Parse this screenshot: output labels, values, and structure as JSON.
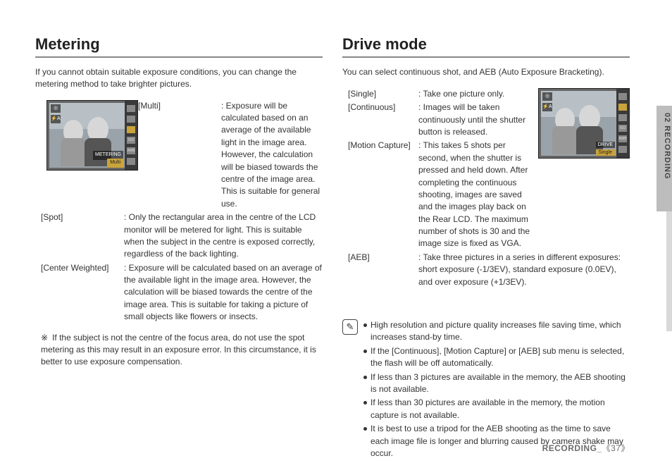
{
  "sideTab": "02 RECORDING",
  "footer": {
    "section": "RECORDING_",
    "page": "37"
  },
  "left": {
    "heading": "Metering",
    "intro": "If you cannot obtain suitable exposure conditions, you can change the metering method to take brighter pictures.",
    "camLabel": "METERING",
    "camLabel2": "Multi",
    "items": [
      {
        "term": "[Multi]",
        "desc": ": Exposure will be calculated based on an average of the available light in the image area. However, the calculation will be biased towards the centre of the image area. This is suitable for general use."
      },
      {
        "term": "[Spot]",
        "desc": ": Only the rectangular area in the centre of the LCD monitor will be metered for light. This is suitable when the subject in the centre is exposed correctly, regardless of the back lighting."
      },
      {
        "term": "[Center Weighted]",
        "desc": ": Exposure will be calculated based on an average of the available light in the image area. However, the calculation will be biased towards the centre of the image area. This is suitable for taking a picture of small objects like flowers or insects."
      }
    ],
    "note": "If the subject is not the centre of the focus area, do not use the spot metering as this may result in an exposure error. In this circumstance, it is better to use exposure compensation."
  },
  "right": {
    "heading": "Drive mode",
    "intro": "You can select continuous shot, and AEB (Auto Exposure Bracketing).",
    "camLabel": "DRIVE",
    "camLabel2": "Single",
    "items": [
      {
        "term": "[Single]",
        "desc": ": Take one picture only."
      },
      {
        "term": "[Continuous]",
        "desc": ": Images will be taken continuously until the shutter button is released."
      },
      {
        "term": "[Motion Capture]",
        "desc": ": This takes 5 shots per second, when the shutter is pressed and held down. After completing the continuous shooting, images are saved and the images play back on the Rear LCD. The maximum number of shots is 30 and the image size is fixed as VGA."
      },
      {
        "term": "[AEB]",
        "desc": ": Take three pictures in a series in different exposures: short exposure (-1/3EV), standard exposure (0.0EV), and over exposure (+1/3EV)."
      }
    ],
    "tips": [
      "High resolution and picture quality increases file saving time, which increases stand-by time.",
      "If the [Continuous], [Motion Capture] or [AEB] sub menu is selected, the flash will be off automatically.",
      "If less than 3 pictures are available in the memory, the AEB shooting is not available.",
      "If less than 30 pictures are available in the memory, the motion capture is not available.",
      "It is best to use a tripod for the AEB shooting as the time to save each image file is longer and blurring caused by camera shake may occur."
    ]
  }
}
